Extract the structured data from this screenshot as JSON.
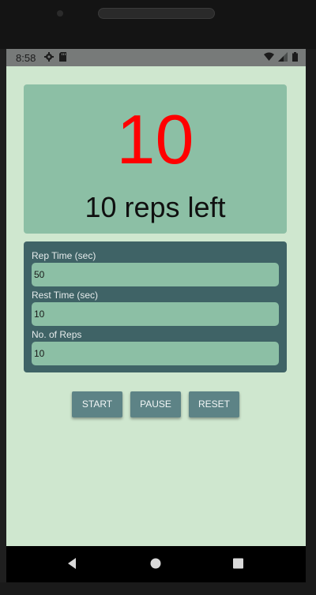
{
  "status_bar": {
    "time": "8:58",
    "left_icons": [
      "gear-icon",
      "sd-card-icon"
    ],
    "right_icons": [
      "wifi-icon",
      "signal-icon",
      "battery-icon"
    ]
  },
  "display": {
    "count": "10",
    "reps_left_text": "10 reps left",
    "count_color": "#ff0000"
  },
  "settings": {
    "rep_time": {
      "label": "Rep Time (sec)",
      "value": "50"
    },
    "rest_time": {
      "label": "Rest Time (sec)",
      "value": "10"
    },
    "num_reps": {
      "label": "No. of Reps",
      "value": "10"
    }
  },
  "buttons": {
    "start": "START",
    "pause": "PAUSE",
    "reset": "RESET"
  },
  "nav": {
    "icons": [
      "back-icon",
      "home-icon",
      "recents-icon"
    ]
  },
  "colors": {
    "screen_bg": "#cfe7cf",
    "card_bg": "#8cbfa5",
    "settings_bg": "#3f6366",
    "button_bg": "#5d8386"
  }
}
